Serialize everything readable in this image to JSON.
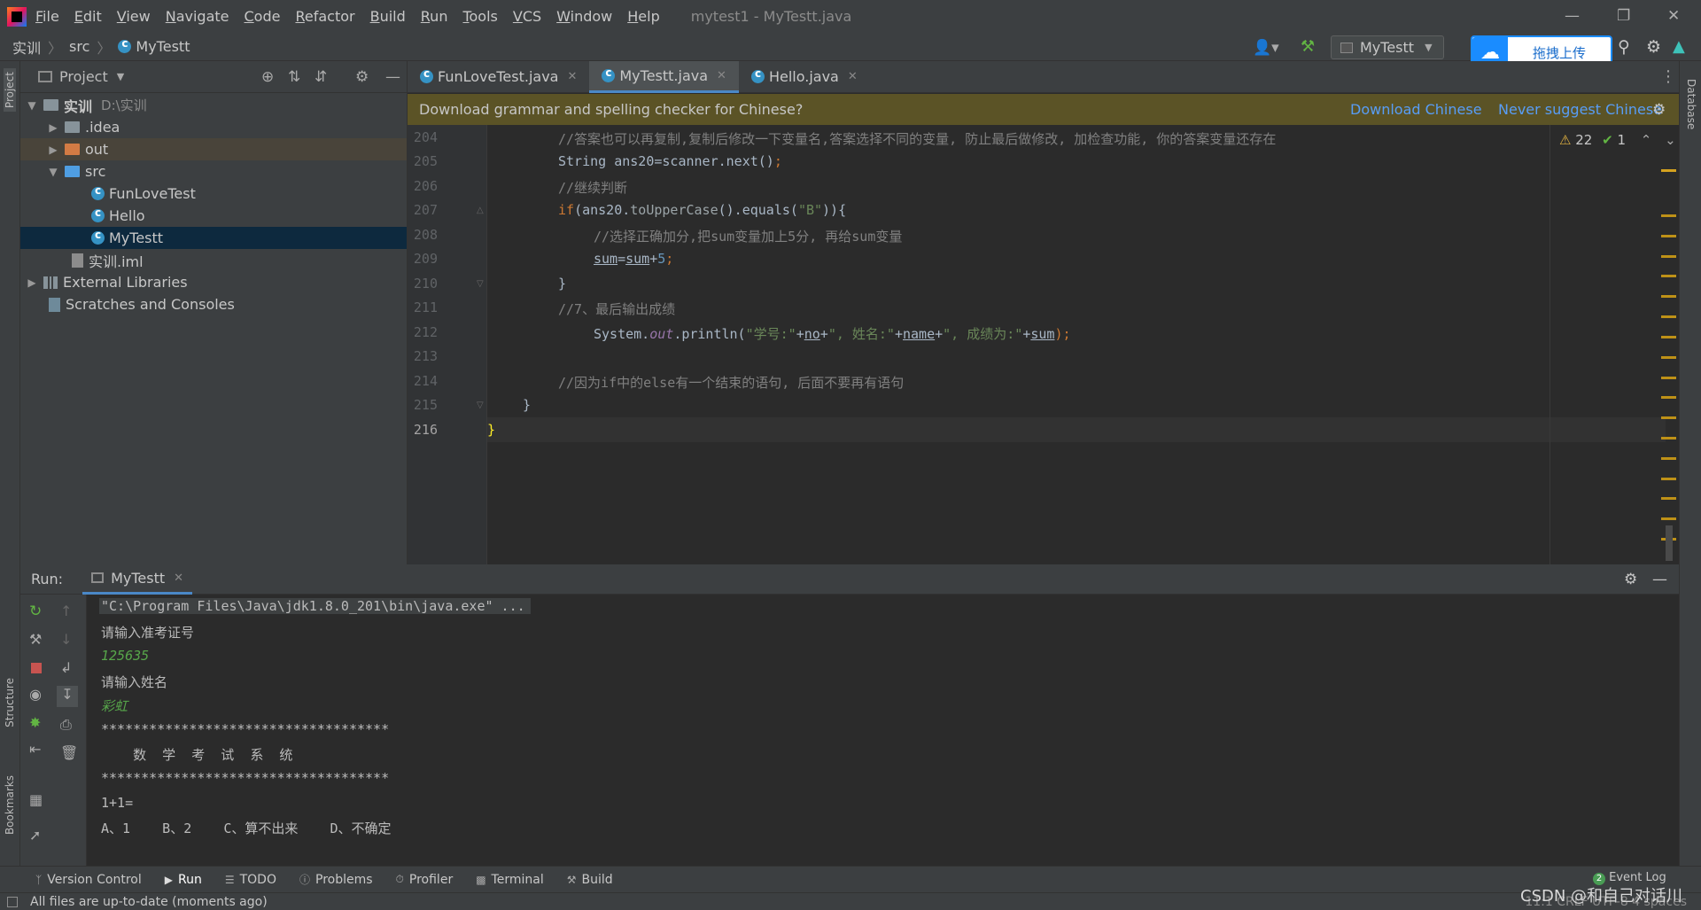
{
  "titlebar": {
    "menu": [
      "File",
      "Edit",
      "View",
      "Navigate",
      "Code",
      "Refactor",
      "Build",
      "Run",
      "Tools",
      "VCS",
      "Window",
      "Help"
    ],
    "window_title": "mytest1 - MyTestt.java"
  },
  "navbar": {
    "crumbs": [
      "实训",
      "src",
      "MyTestt"
    ],
    "run_config": "MyTestt",
    "upload_label": "拖拽上传"
  },
  "project": {
    "title": "Project",
    "tree": [
      {
        "label": "实训",
        "path": "D:\\实训"
      },
      {
        "label": ".idea"
      },
      {
        "label": "out"
      },
      {
        "label": "src"
      },
      {
        "label": "FunLoveTest"
      },
      {
        "label": "Hello"
      },
      {
        "label": "MyTestt"
      },
      {
        "label": "实训.iml"
      },
      {
        "label": "External Libraries"
      },
      {
        "label": "Scratches and Consoles"
      }
    ]
  },
  "tabs": [
    "FunLoveTest.java",
    "MyTestt.java",
    "Hello.java"
  ],
  "notification": {
    "text": "Download grammar and spelling checker for Chinese?",
    "download": "Download Chinese",
    "never": "Never suggest Chinese"
  },
  "inspections": {
    "warnings": "22",
    "ok": "1"
  },
  "editor": {
    "lines": [
      "204",
      "205",
      "206",
      "207",
      "208",
      "209",
      "210",
      "211",
      "212",
      "213",
      "214",
      "215",
      "216"
    ],
    "code": {
      "l204": "//答案也可以再复制,复制后修改一下变量名,答案选择不同的变量, 防止最后做修改, 加检查功能, 你的答案变量还存在",
      "l205a": "String ans20=scanner.next()",
      "l205b": ";",
      "l206": "//继续判断",
      "l207_kw": "if",
      "l207_a": "(ans20.",
      "l207_m": "toUpperCase",
      "l207_b": "().equals(",
      "l207_s": "\"B\"",
      "l207_c": ")){",
      "l208": "//选择正确加分,把sum变量加上5分, 再给sum变量",
      "l209_a": "sum",
      "l209_b": "=",
      "l209_c": "sum",
      "l209_d": "+",
      "l209_e": "5",
      "l209_f": ";",
      "l210": "}",
      "l211": "//7、最后输出成绩",
      "l212_a": "System.",
      "l212_out": "out",
      "l212_b": ".println(",
      "l212_s1": "\"学号:\"",
      "l212_p1": "+",
      "l212_no": "no",
      "l212_p2": "+",
      "l212_s2": "\", 姓名:\"",
      "l212_p3": "+",
      "l212_name": "name",
      "l212_p4": "+",
      "l212_s3": "\", 成绩为:\"",
      "l212_p5": "+",
      "l212_sum": "sum",
      "l212_end": ");",
      "l214": "//因为if中的else有一个结束的语句, 后面不要再有语句",
      "l215": "}",
      "l216": "}"
    }
  },
  "run": {
    "label": "Run:",
    "tab": "MyTestt",
    "console": [
      "\"C:\\Program Files\\Java\\jdk1.8.0_201\\bin\\java.exe\" ...",
      "请输入准考证号",
      "125635",
      "请输入姓名",
      "彩虹",
      "************************************",
      "    数  学  考  试  系  统",
      "************************************",
      "1+1=",
      "A、1    B、2    C、算不出来    D、不确定"
    ]
  },
  "bottom_tabs": [
    "Version Control",
    "Run",
    "TODO",
    "Problems",
    "Profiler",
    "Terminal",
    "Build"
  ],
  "event_log": {
    "count": "2",
    "label": "Event Log"
  },
  "status": {
    "message": "All files are up-to-date (moments ago)",
    "right": "11:1   CRLF   UTF-8   4 spaces"
  },
  "side_labels": {
    "project": "Project",
    "structure": "Structure",
    "bookmarks": "Bookmarks",
    "database": "Database"
  },
  "watermark": "CSDN @和自己对话川"
}
